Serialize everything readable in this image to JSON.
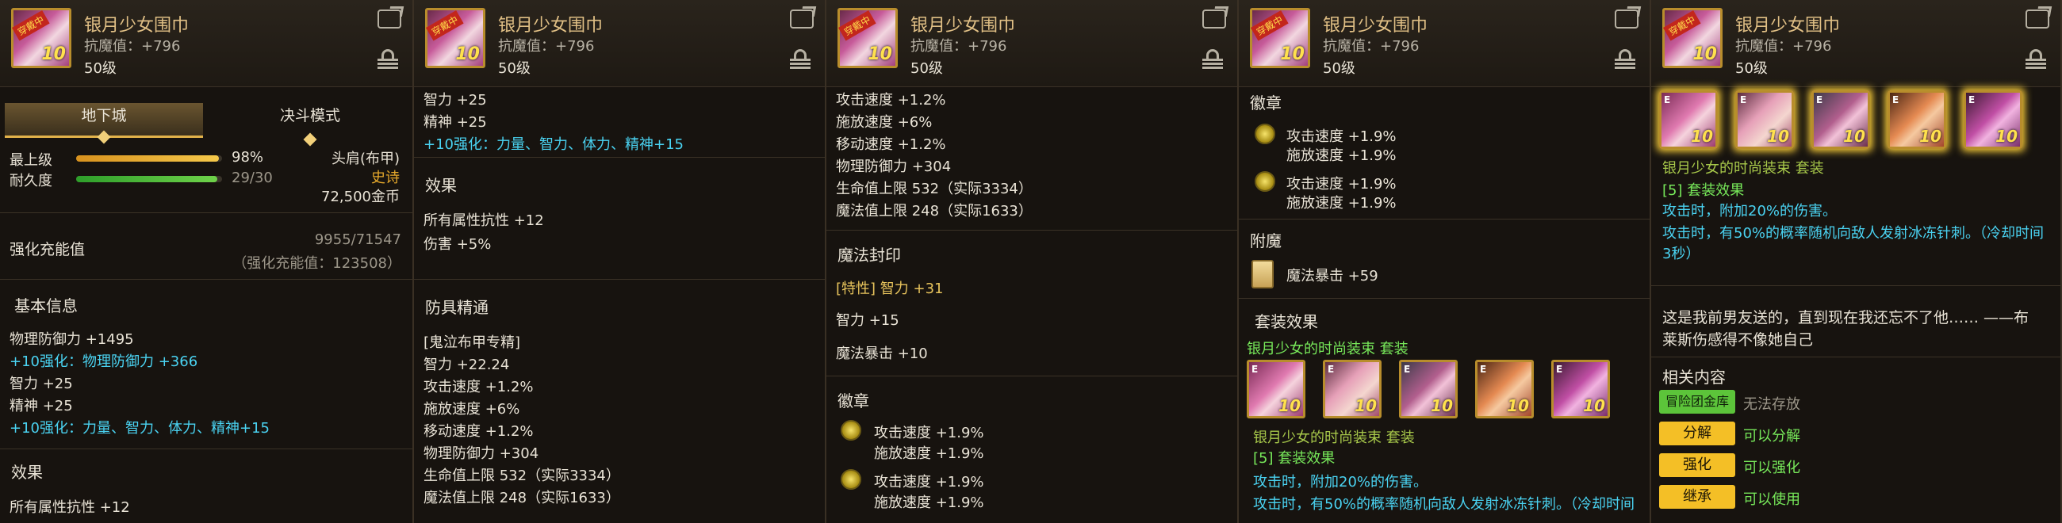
{
  "item": {
    "name": "银月少女围巾",
    "resist": "抗魔值：+796",
    "level": "50级",
    "icon_tag": "穿戴中",
    "icon_level": "10"
  },
  "p1": {
    "tabs": [
      "地下城",
      "决斗模式"
    ],
    "grade_label": "最上级",
    "grade_value": "98%",
    "grade_fill": 0.98,
    "dur_label": "耐久度",
    "dur_value": "29/30",
    "dur_fill": 0.967,
    "slot": "头肩(布甲)",
    "rarity": "史诗",
    "price": "72,500金币",
    "enh_label": "强化充能值",
    "enh_value": "9955/71547",
    "enh_sub": "（强化充能值：123508）",
    "basic_title": "基本信息",
    "lines": [
      {
        "t": "物理防御力 +1495",
        "c": "white"
      },
      {
        "t": "+10强化：物理防御力 +366",
        "c": "cyan"
      },
      {
        "t": "智力 +25",
        "c": "white"
      },
      {
        "t": "精神 +25",
        "c": "white"
      },
      {
        "t": "+10强化：力量、智力、体力、精神+15",
        "c": "cyan"
      }
    ],
    "effect_title": "效果",
    "effect_line": "所有属性抗性 +12"
  },
  "p2": {
    "top": [
      {
        "t": "智力 +25",
        "c": "white"
      },
      {
        "t": "精神 +25",
        "c": "white"
      },
      {
        "t": "+10强化：力量、智力、体力、精神+15",
        "c": "cyan"
      }
    ],
    "effect_title": "效果",
    "effects": [
      "所有属性抗性 +12",
      "伤害 +5%"
    ],
    "mastery_title": "防具精通",
    "mastery": [
      "[鬼泣布甲专精]",
      "智力 +22.24",
      "攻击速度 +1.2%",
      "施放速度 +6%",
      "移动速度 +1.2%",
      "物理防御力 +304",
      "生命值上限 532（实际3334）",
      "魔法值上限 248（实际1633）"
    ]
  },
  "p3": {
    "top": [
      "攻击速度 +1.2%",
      "施放速度 +6%",
      "移动速度 +1.2%",
      "物理防御力 +304",
      "生命值上限 532（实际3334）",
      "魔法值上限 248（实际1633）"
    ],
    "seal_title": "魔法封印",
    "seal_special": "[特性] 智力 +31",
    "seal_lines": [
      "智力 +15",
      "魔法暴击 +10"
    ],
    "emblem_title": "徽章",
    "emblems": [
      {
        "a": "攻击速度 +1.9%",
        "b": "施放速度 +1.9%"
      },
      {
        "a": "攻击速度 +1.9%",
        "b": "施放速度 +1.9%"
      }
    ]
  },
  "p4": {
    "emblem_title": "徽章",
    "emblems": [
      {
        "a": "攻击速度 +1.9%",
        "b": "施放速度 +1.9%"
      },
      {
        "a": "攻击速度 +1.9%",
        "b": "施放速度 +1.9%"
      }
    ],
    "enchant_title": "附魔",
    "enchant": "魔法暴击 +59",
    "set_title": "套装效果",
    "set_name": "银月少女的时尚装束 套装",
    "set_name2": "银月少女的时尚装束 套装",
    "set_count": "[5] 套装效果",
    "set_lines": [
      "攻击时，附加20%的伤害。",
      "攻击时，有50%的概率随机向敌人发射冰冻针刺。（冷却时间"
    ]
  },
  "p5": {
    "set_name": "银月少女的时尚装束 套装",
    "set_count": "[5] 套装效果",
    "set_lines": [
      "攻击时，附加20%的伤害。",
      "攻击时，有50%的概率随机向敌人发射冰冻针刺。（冷却时间",
      "3秒）"
    ],
    "flavor": [
      "这是我前男友送的，直到现在我还忘不了他…… ——布",
      "莱斯伤感得不像她自己"
    ],
    "related_title": "相关内容",
    "actions": [
      {
        "btn": "冒险团金库",
        "txt": "无法存放",
        "kind": "g",
        "tc": "gray"
      },
      {
        "btn": "分解",
        "txt": "可以分解",
        "kind": "y",
        "tc": "green"
      },
      {
        "btn": "强化",
        "txt": "可以强化",
        "kind": "y",
        "tc": "green"
      },
      {
        "btn": "继承",
        "txt": "可以使用",
        "kind": "y",
        "tc": "green"
      }
    ]
  },
  "colors": {
    "name": "#e0bf85",
    "cyan": "#4ad3f2",
    "green": "#77e85a",
    "yellow_button": "#f4bf26",
    "green_button": "#5cc43a"
  }
}
